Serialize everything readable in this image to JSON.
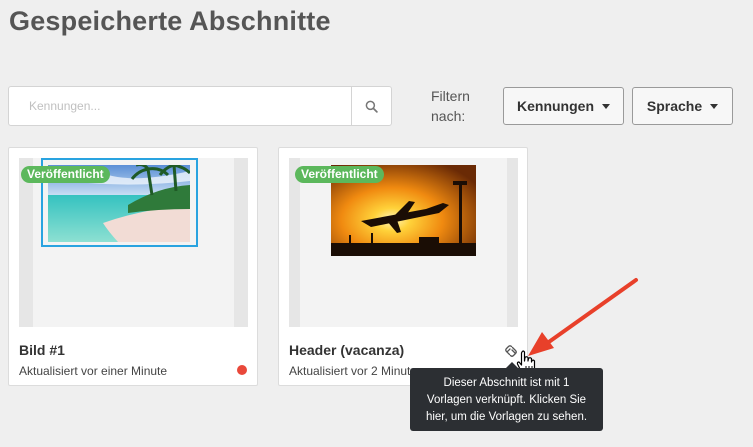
{
  "page": {
    "title": "Gespeicherte Abschnitte"
  },
  "search": {
    "placeholder": "Kennungen..."
  },
  "filter": {
    "label_line1": "Filtern",
    "label_line2": "nach:",
    "dropdowns": [
      "Kennungen",
      "Sprache"
    ]
  },
  "cards": [
    {
      "badge": "Veröffentlicht",
      "title": "Bild #1",
      "updated": "Aktualisiert vor einer Minute",
      "status_color": "#e9483a",
      "image": "tropical-beach"
    },
    {
      "badge": "Veröffentlicht",
      "title": "Header (vacanza)",
      "updated": "Aktualisiert vor 2 Minute",
      "image": "airplane-sunset",
      "link_icon": "link-icon"
    }
  ],
  "tooltip": {
    "line1": "Dieser Abschnitt ist mit  1",
    "line2": "Vorlagen verknüpft. Klicken Sie",
    "line3": "hier, um die Vorlagen zu sehen."
  },
  "colors": {
    "badge": "#5cb85c",
    "selection_border": "#29a3e0",
    "annotation_arrow": "#e8402a",
    "tooltip_bg": "#2c2f33"
  }
}
